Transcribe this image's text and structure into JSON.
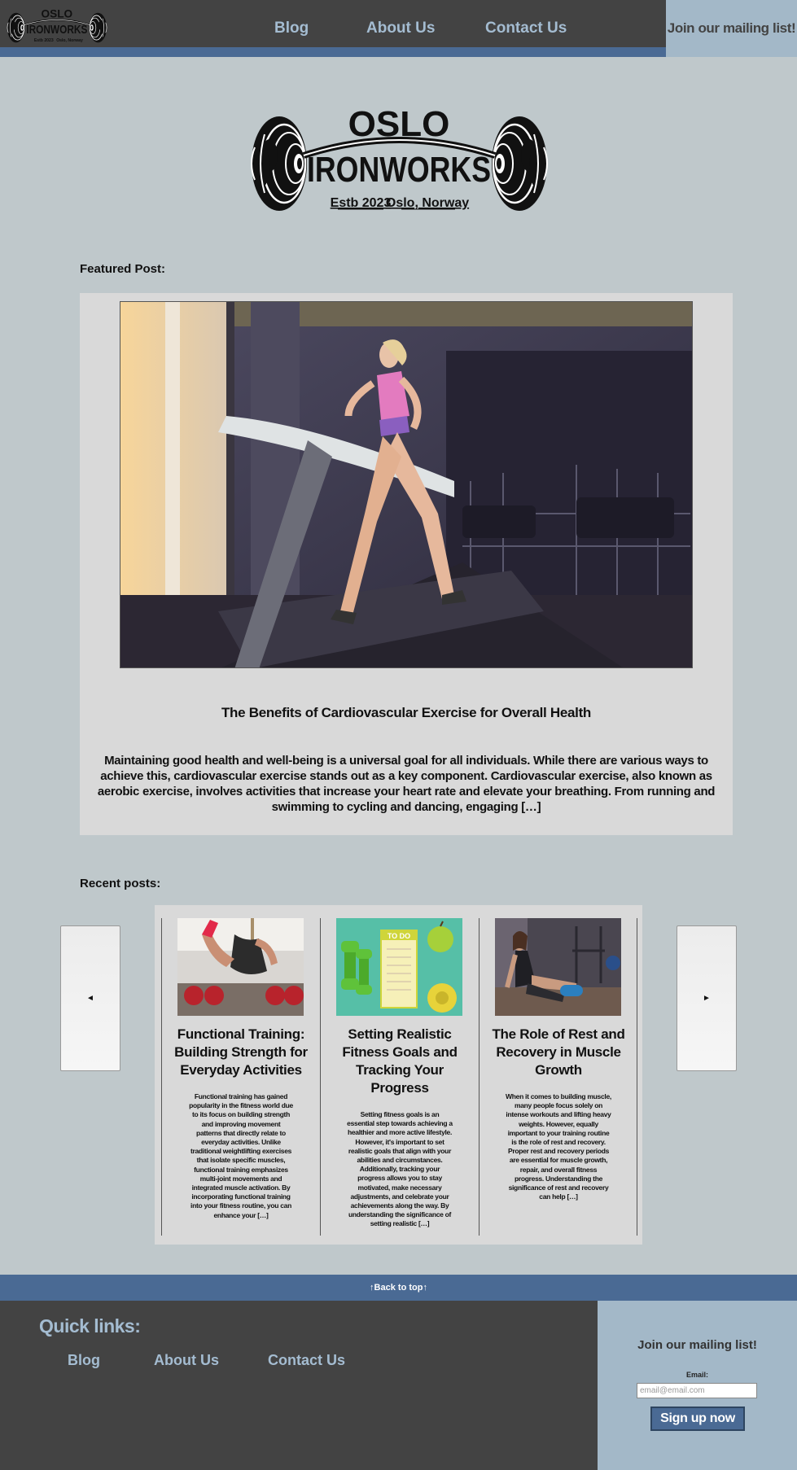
{
  "brand": {
    "name_top": "OSLO",
    "name_bottom": "IRONWORKS",
    "established": "Estb 2023",
    "location": "Oslo, Norway"
  },
  "nav": {
    "blog": "Blog",
    "about": "About Us",
    "contact": "Contact Us",
    "join": "Join our mailing list!"
  },
  "featured": {
    "label": "Featured Post:",
    "title": "The Benefits of Cardiovascular Exercise for Overall Health",
    "excerpt": "Maintaining good health and well-being is a universal goal for all individuals. While there are various ways to achieve this, cardiovascular exercise stands out as a key component. Cardiovascular exercise, also known as aerobic exercise, involves activities that increase your heart rate and elevate your breathing. From running and swimming to cycling and dancing, engaging […]"
  },
  "recent": {
    "label": "Recent posts:",
    "prev": "◄",
    "next": "►",
    "posts": [
      {
        "title": "Functional Training: Building Strength for Everyday Activities",
        "excerpt": "Functional training has gained popularity in the fitness world due to its focus on building strength and improving movement patterns that directly relate to everyday activities. Unlike traditional weightlifting exercises that isolate specific muscles, functional training emphasizes multi-joint movements and integrated muscle activation. By incorporating functional training into your fitness routine, you can enhance your […]"
      },
      {
        "title": "Setting Realistic Fitness Goals and Tracking Your Progress",
        "excerpt": "Setting fitness goals is an essential step towards achieving a healthier and more active lifestyle. However, it's important to set realistic goals that align with your abilities and circumstances. Additionally, tracking your progress allows you to stay motivated, make necessary adjustments, and celebrate your achievements along the way. By understanding the significance of setting realistic […]",
        "todo_text": "TO DO"
      },
      {
        "title": "The Role of Rest and Recovery in Muscle Growth",
        "excerpt": "When it comes to building muscle, many people focus solely on intense workouts and lifting heavy weights. However, equally important to your training routine is the role of rest and recovery. Proper rest and recovery periods are essential for muscle growth, repair, and overall fitness progress. Understanding the significance of rest and recovery can help […]"
      }
    ]
  },
  "footer": {
    "back_to_top": "↑Back to top↑",
    "quick_links_title": "Quick links:",
    "links": {
      "blog": "Blog",
      "about": "About Us",
      "contact": "Contact Us"
    },
    "mailing": {
      "title": "Join our mailing list!",
      "email_label": "Email:",
      "email_placeholder": "email@email.com",
      "signup": "Sign up now"
    }
  },
  "colors": {
    "header_bg": "#434343",
    "accent_blue": "#4a6a94",
    "link_blue": "#a4bcd1",
    "page_bg": "#bfc8cb",
    "panel_bg": "#d9d9d9",
    "mailing_bg": "#a3b8c8"
  }
}
